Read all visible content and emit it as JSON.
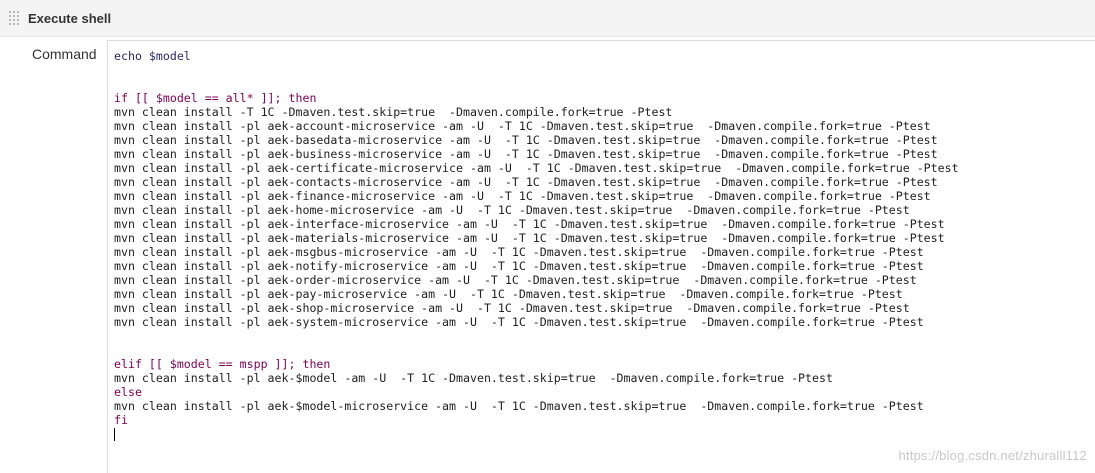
{
  "section": {
    "title": "Execute shell"
  },
  "field": {
    "label": "Command"
  },
  "editor": {
    "lines": [
      "echo $model",
      "",
      "",
      "if [[ $model == all* ]]; then",
      "mvn clean install -T 1C -Dmaven.test.skip=true  -Dmaven.compile.fork=true -Ptest",
      "mvn clean install -pl aek-account-microservice -am -U  -T 1C -Dmaven.test.skip=true  -Dmaven.compile.fork=true -Ptest",
      "mvn clean install -pl aek-basedata-microservice -am -U  -T 1C -Dmaven.test.skip=true  -Dmaven.compile.fork=true -Ptest",
      "mvn clean install -pl aek-business-microservice -am -U  -T 1C -Dmaven.test.skip=true  -Dmaven.compile.fork=true -Ptest",
      "mvn clean install -pl aek-certificate-microservice -am -U  -T 1C -Dmaven.test.skip=true  -Dmaven.compile.fork=true -Ptest",
      "mvn clean install -pl aek-contacts-microservice -am -U  -T 1C -Dmaven.test.skip=true  -Dmaven.compile.fork=true -Ptest",
      "mvn clean install -pl aek-finance-microservice -am -U  -T 1C -Dmaven.test.skip=true  -Dmaven.compile.fork=true -Ptest",
      "mvn clean install -pl aek-home-microservice -am -U  -T 1C -Dmaven.test.skip=true  -Dmaven.compile.fork=true -Ptest",
      "mvn clean install -pl aek-interface-microservice -am -U  -T 1C -Dmaven.test.skip=true  -Dmaven.compile.fork=true -Ptest",
      "mvn clean install -pl aek-materials-microservice -am -U  -T 1C -Dmaven.test.skip=true  -Dmaven.compile.fork=true -Ptest",
      "mvn clean install -pl aek-msgbus-microservice -am -U  -T 1C -Dmaven.test.skip=true  -Dmaven.compile.fork=true -Ptest",
      "mvn clean install -pl aek-notify-microservice -am -U  -T 1C -Dmaven.test.skip=true  -Dmaven.compile.fork=true -Ptest",
      "mvn clean install -pl aek-order-microservice -am -U  -T 1C -Dmaven.test.skip=true  -Dmaven.compile.fork=true -Ptest",
      "mvn clean install -pl aek-pay-microservice -am -U  -T 1C -Dmaven.test.skip=true  -Dmaven.compile.fork=true -Ptest",
      "mvn clean install -pl aek-shop-microservice -am -U  -T 1C -Dmaven.test.skip=true  -Dmaven.compile.fork=true -Ptest",
      "mvn clean install -pl aek-system-microservice -am -U  -T 1C -Dmaven.test.skip=true  -Dmaven.compile.fork=true -Ptest",
      "",
      "",
      "elif [[ $model == mspp ]]; then",
      "mvn clean install -pl aek-$model -am -U  -T 1C -Dmaven.test.skip=true  -Dmaven.compile.fork=true -Ptest",
      "else",
      "mvn clean install -pl aek-$model-microservice -am -U  -T 1C -Dmaven.test.skip=true  -Dmaven.compile.fork=true -Ptest",
      "fi",
      ""
    ]
  },
  "watermark": {
    "text": "https://blog.csdn.net/zhuralll112"
  },
  "colors": {
    "header_bg": "#f4f4f4",
    "code_text": "#2a2a6a",
    "keyword": "#7f0055",
    "watermark": "#c8c8c8"
  },
  "icons": {
    "drag_handle": "drag-handle-icon"
  }
}
